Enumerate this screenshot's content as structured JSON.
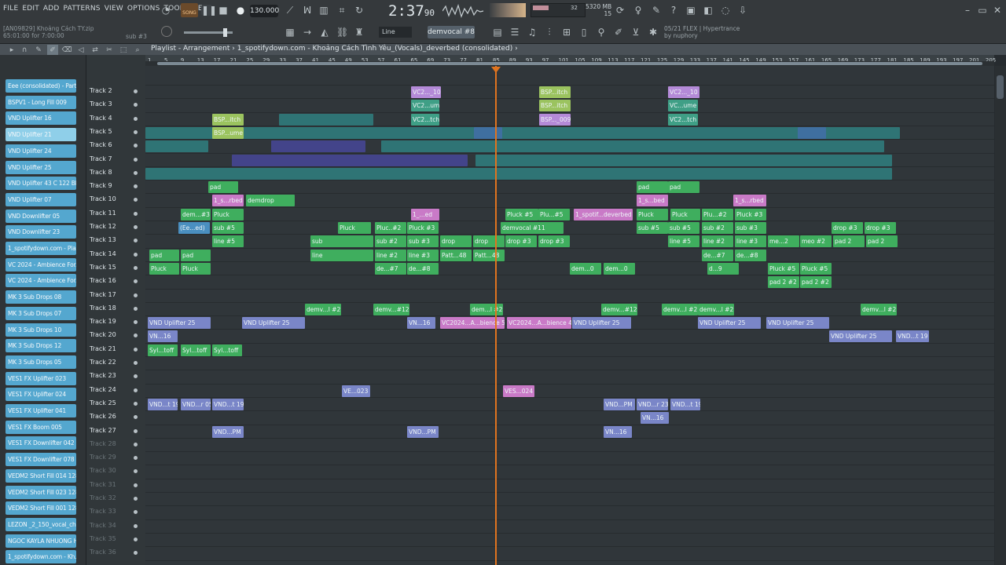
{
  "menu": [
    "FILE",
    "EDIT",
    "ADD",
    "PATTERNS",
    "VIEW",
    "OPTIONS",
    "TOOLS",
    "HELP"
  ],
  "transport": {
    "song_label": "SONG",
    "tempo": "130.000",
    "time_main": "2:37",
    "time_sub": "90"
  },
  "hint_text": {
    "line1": "[AN09829] Khoảng Cách TY.zip",
    "line2": "65:01:00 for 7:00:00",
    "right": "sub #3"
  },
  "mem": {
    "mem": "5320 MB",
    "voices": "15",
    "cpu": "32"
  },
  "snap": "Line",
  "pattern": "demvocal #8",
  "plugin_hint": {
    "line1": "05/21 FLEX | Hypertrance",
    "line2": "by nuphory"
  },
  "playlist": {
    "title": "Playlist - Arrangement",
    "breadcrumb": "1_spotifydown.com - Khoảng Cách Tình Yêu_(Vocals)_deverbed (consolidated)"
  },
  "browser_items": [
    "Eee (consolidated) - Part...",
    "BSPV1 - Long Fill 009",
    "VND Uplifter 16",
    "VND Uplifter 21",
    "VND Uplifter 24",
    "VND Uplifter 25",
    "VND Uplifter 43 C 122 BPM",
    "VND Uplifter 07",
    "VND Downlifter 05",
    "VND Downlifter 23",
    "1_spotifydown.com - Pla...",
    "VC 2024 - Ambience For...",
    "VC 2024 - Ambience For...",
    "MK 3 Sub Drops 08",
    "MK 3 Sub Drops 07",
    "MK 3 Sub Drops 10",
    "MK 3 Sub Drops 12",
    "MK 3 Sub Drops 05",
    "VES1 FX Uplifter 023",
    "VES1 FX Uplifter 024",
    "VES1 FX Uplifter 041",
    "VES1 FX Boom 005",
    "VES1 FX Downlifter 042",
    "VES1 FX Downlifter 078",
    "VEDM2 Short Fill 014 128...",
    "VEDM2 Short Fill 023 128...",
    "VEDM2 Short Fill 001 128...",
    "LEZON _2_150_vocal_ch...",
    "NGOC KAYLA NHUONG HAN...",
    "1_spotifydown.com - Kh..."
  ],
  "tracks": [
    "Track 2",
    "Track 3",
    "Track 4",
    "Track 5",
    "Track 6",
    "Track 7",
    "Track 8",
    "Track 9",
    "Track 10",
    "Track 11",
    "Track 12",
    "Track 13",
    "Track 14",
    "Track 15",
    "Track 16",
    "Track 17",
    "Track 18",
    "Track 19",
    "Track 20",
    "Track 21",
    "Track 22",
    "Track 23",
    "Track 24",
    "Track 25",
    "Track 26",
    "Track 27",
    "Track 28",
    "Track 29",
    "Track 30",
    "Track 31",
    "Track 32",
    "Track 33",
    "Track 34",
    "Track 35",
    "Track 36"
  ],
  "ruler": [
    "1",
    "5",
    "9",
    "13",
    "17",
    "21",
    "25",
    "29",
    "33",
    "37",
    "41",
    "45",
    "49",
    "53",
    "57",
    "61",
    "65",
    "69",
    "73",
    "77",
    "81",
    "85",
    "89",
    "93",
    "97",
    "101",
    "105",
    "109",
    "113",
    "117",
    "121",
    "125",
    "129",
    "133",
    "137",
    "141",
    "145",
    "149",
    "153",
    "157",
    "161",
    "165",
    "169",
    "173",
    "177",
    "181",
    "185",
    "189",
    "193",
    "197",
    "201",
    "205"
  ],
  "clips": [
    {
      "row": 0,
      "start": 338,
      "w": 38,
      "label": "VC2..._10",
      "color": "#b48ad8"
    },
    {
      "row": 0,
      "start": 501,
      "w": 40,
      "label": "BSP...itch",
      "color": "#9bc35f"
    },
    {
      "row": 0,
      "start": 665,
      "w": 40,
      "label": "VC2..._10",
      "color": "#b48ad8"
    },
    {
      "row": 1,
      "start": 338,
      "w": 36,
      "label": "VC2...ume",
      "color": "#3f9f86"
    },
    {
      "row": 1,
      "start": 501,
      "w": 40,
      "label": "BSP...itch",
      "color": "#9bc35f"
    },
    {
      "row": 1,
      "start": 665,
      "w": 38,
      "label": "VC...ume",
      "color": "#3f9f86"
    },
    {
      "row": 2,
      "start": 85,
      "w": 40,
      "label": "BSP...itch",
      "color": "#9bc35f"
    },
    {
      "row": 2,
      "start": 338,
      "w": 36,
      "label": "VC2...tch",
      "color": "#3f9f86"
    },
    {
      "row": 2,
      "start": 501,
      "w": 40,
      "label": "BSP..._009",
      "color": "#b48ad8"
    },
    {
      "row": 2,
      "start": 665,
      "w": 38,
      "label": "VC2...tch",
      "color": "#3f9f86"
    },
    {
      "row": 3,
      "start": 85,
      "w": 40,
      "label": "BSP...ume",
      "color": "#9bc35f"
    },
    {
      "row": 3,
      "start": 418,
      "w": 36,
      "label": "",
      "color": "#3f6fa0"
    },
    {
      "row": 3,
      "start": 830,
      "w": 36,
      "label": "",
      "color": "#3f6fa0"
    },
    {
      "row": 7,
      "start": 80,
      "w": 38,
      "label": "pad",
      "color": "#3fae5e"
    },
    {
      "row": 7,
      "start": 625,
      "w": 40,
      "label": "pad",
      "color": "#3fae5e"
    },
    {
      "row": 7,
      "start": 665,
      "w": 40,
      "label": "pad",
      "color": "#3fae5e"
    },
    {
      "row": 8,
      "start": 85,
      "w": 40,
      "label": "1_s...rbed",
      "color": "#c97ac7"
    },
    {
      "row": 8,
      "start": 128,
      "w": 62,
      "label": "demdrop",
      "color": "#3fae5e"
    },
    {
      "row": 8,
      "start": 625,
      "w": 40,
      "label": "1_s...bed",
      "color": "#c97ac7"
    },
    {
      "row": 8,
      "start": 748,
      "w": 42,
      "label": "1_s...rbed",
      "color": "#c97ac7"
    },
    {
      "row": 9,
      "start": 45,
      "w": 38,
      "label": "dem...#3",
      "color": "#3fae5e"
    },
    {
      "row": 9,
      "start": 85,
      "w": 40,
      "label": "Pluck",
      "color": "#3fae5e"
    },
    {
      "row": 9,
      "start": 338,
      "w": 36,
      "label": "1_...ed",
      "color": "#c97ac7"
    },
    {
      "row": 9,
      "start": 458,
      "w": 42,
      "label": "Pluck #5",
      "color": "#3fae5e"
    },
    {
      "row": 9,
      "start": 500,
      "w": 40,
      "label": "Plu...#5",
      "color": "#3fae5e"
    },
    {
      "row": 9,
      "start": 545,
      "w": 75,
      "label": "1_spotif...deverbed",
      "color": "#c97ac7"
    },
    {
      "row": 9,
      "start": 625,
      "w": 40,
      "label": "Pluck",
      "color": "#3fae5e"
    },
    {
      "row": 9,
      "start": 668,
      "w": 38,
      "label": "Pluck",
      "color": "#3fae5e"
    },
    {
      "row": 9,
      "start": 708,
      "w": 40,
      "label": "Plu...#2",
      "color": "#3fae5e"
    },
    {
      "row": 9,
      "start": 750,
      "w": 40,
      "label": "Pluck #3",
      "color": "#3fae5e"
    },
    {
      "row": 10,
      "start": 42,
      "w": 40,
      "label": "(Ee...ed)",
      "color": "#4a8fc0"
    },
    {
      "row": 10,
      "start": 85,
      "w": 40,
      "label": "sub #5",
      "color": "#3fae5e"
    },
    {
      "row": 10,
      "start": 245,
      "w": 42,
      "label": "Pluck",
      "color": "#3fae5e"
    },
    {
      "row": 10,
      "start": 292,
      "w": 40,
      "label": "Pluc..#2",
      "color": "#3fae5e"
    },
    {
      "row": 10,
      "start": 333,
      "w": 40,
      "label": "Pluck #3",
      "color": "#3fae5e"
    },
    {
      "row": 10,
      "start": 452,
      "w": 80,
      "label": "demvocal #11",
      "color": "#3fae5e"
    },
    {
      "row": 10,
      "start": 625,
      "w": 40,
      "label": "sub #5",
      "color": "#3fae5e"
    },
    {
      "row": 10,
      "start": 665,
      "w": 40,
      "label": "sub #5",
      "color": "#3fae5e"
    },
    {
      "row": 10,
      "start": 708,
      "w": 40,
      "label": "sub #2",
      "color": "#3fae5e"
    },
    {
      "row": 10,
      "start": 750,
      "w": 40,
      "label": "sub #3",
      "color": "#3fae5e"
    },
    {
      "row": 10,
      "start": 873,
      "w": 40,
      "label": "drop #3",
      "color": "#3fae5e"
    },
    {
      "row": 10,
      "start": 915,
      "w": 40,
      "label": "drop #3",
      "color": "#3fae5e"
    },
    {
      "row": 11,
      "start": 85,
      "w": 40,
      "label": "line #5",
      "color": "#3fae5e"
    },
    {
      "row": 11,
      "start": 210,
      "w": 80,
      "label": "sub",
      "color": "#3fae5e"
    },
    {
      "row": 11,
      "start": 292,
      "w": 40,
      "label": "sub #2",
      "color": "#3fae5e"
    },
    {
      "row": 11,
      "start": 333,
      "w": 40,
      "label": "sub #3",
      "color": "#3fae5e"
    },
    {
      "row": 11,
      "start": 375,
      "w": 40,
      "label": "drop",
      "color": "#3fae5e"
    },
    {
      "row": 11,
      "start": 417,
      "w": 40,
      "label": "drop",
      "color": "#3fae5e"
    },
    {
      "row": 11,
      "start": 458,
      "w": 40,
      "label": "drop #3",
      "color": "#3fae5e"
    },
    {
      "row": 11,
      "start": 500,
      "w": 40,
      "label": "drop #3",
      "color": "#3fae5e"
    },
    {
      "row": 11,
      "start": 665,
      "w": 40,
      "label": "line #5",
      "color": "#3fae5e"
    },
    {
      "row": 11,
      "start": 708,
      "w": 40,
      "label": "line #2",
      "color": "#3fae5e"
    },
    {
      "row": 11,
      "start": 750,
      "w": 40,
      "label": "line #3",
      "color": "#3fae5e"
    },
    {
      "row": 11,
      "start": 792,
      "w": 40,
      "label": "me...2",
      "color": "#3fae5e"
    },
    {
      "row": 11,
      "start": 833,
      "w": 40,
      "label": "meo #2",
      "color": "#3fae5e"
    },
    {
      "row": 11,
      "start": 875,
      "w": 40,
      "label": "pad 2",
      "color": "#3fae5e"
    },
    {
      "row": 11,
      "start": 917,
      "w": 40,
      "label": "pad 2",
      "color": "#3fae5e"
    },
    {
      "row": 12,
      "start": 5,
      "w": 38,
      "label": "pad",
      "color": "#3fae5e"
    },
    {
      "row": 12,
      "start": 45,
      "w": 38,
      "label": "pad",
      "color": "#3fae5e"
    },
    {
      "row": 12,
      "start": 210,
      "w": 80,
      "label": "line",
      "color": "#3fae5e"
    },
    {
      "row": 12,
      "start": 292,
      "w": 40,
      "label": "line #2",
      "color": "#3fae5e"
    },
    {
      "row": 12,
      "start": 333,
      "w": 40,
      "label": "line #3",
      "color": "#3fae5e"
    },
    {
      "row": 12,
      "start": 375,
      "w": 40,
      "label": "Patt...48",
      "color": "#3fae5e"
    },
    {
      "row": 12,
      "start": 417,
      "w": 40,
      "label": "Patt...48",
      "color": "#3fae5e"
    },
    {
      "row": 12,
      "start": 708,
      "w": 40,
      "label": "de...#7",
      "color": "#3fae5e"
    },
    {
      "row": 12,
      "start": 750,
      "w": 40,
      "label": "de...#8",
      "color": "#3fae5e"
    },
    {
      "row": 13,
      "start": 5,
      "w": 38,
      "label": "Pluck",
      "color": "#3fae5e"
    },
    {
      "row": 13,
      "start": 45,
      "w": 38,
      "label": "Pluck",
      "color": "#3fae5e"
    },
    {
      "row": 13,
      "start": 292,
      "w": 40,
      "label": "de...#7",
      "color": "#3fae5e"
    },
    {
      "row": 13,
      "start": 333,
      "w": 40,
      "label": "de...#8",
      "color": "#3fae5e"
    },
    {
      "row": 13,
      "start": 540,
      "w": 40,
      "label": "dem...0",
      "color": "#3fae5e"
    },
    {
      "row": 13,
      "start": 583,
      "w": 40,
      "label": "dem...0",
      "color": "#3fae5e"
    },
    {
      "row": 13,
      "start": 715,
      "w": 40,
      "label": "d...9",
      "color": "#3fae5e"
    },
    {
      "row": 13,
      "start": 792,
      "w": 40,
      "label": "Pluck #5",
      "color": "#3fae5e"
    },
    {
      "row": 13,
      "start": 833,
      "w": 40,
      "label": "Pluck #5",
      "color": "#3fae5e"
    },
    {
      "row": 14,
      "start": 792,
      "w": 40,
      "label": "pad 2 #2",
      "color": "#3fae5e"
    },
    {
      "row": 14,
      "start": 833,
      "w": 40,
      "label": "pad 2 #2",
      "color": "#3fae5e"
    },
    {
      "row": 16,
      "start": 203,
      "w": 46,
      "label": "demv...l #2",
      "color": "#3fae5e"
    },
    {
      "row": 16,
      "start": 290,
      "w": 46,
      "label": "demv...#12",
      "color": "#3fae5e"
    },
    {
      "row": 16,
      "start": 413,
      "w": 42,
      "label": "dem...l #2",
      "color": "#3fae5e"
    },
    {
      "row": 16,
      "start": 580,
      "w": 46,
      "label": "demv...#12",
      "color": "#3fae5e"
    },
    {
      "row": 16,
      "start": 657,
      "w": 46,
      "label": "demv...l #2",
      "color": "#3fae5e"
    },
    {
      "row": 16,
      "start": 703,
      "w": 46,
      "label": "demv...l #2",
      "color": "#3fae5e"
    },
    {
      "row": 16,
      "start": 910,
      "w": 46,
      "label": "demv...l #2",
      "color": "#3fae5e"
    },
    {
      "row": 17,
      "start": 3,
      "w": 80,
      "label": "VND Uplifter 25",
      "color": "#7a86c8"
    },
    {
      "row": 17,
      "start": 123,
      "w": 80,
      "label": "VND Uplifter 25",
      "color": "#7a86c8"
    },
    {
      "row": 17,
      "start": 333,
      "w": 36,
      "label": "VN...16",
      "color": "#7a86c8"
    },
    {
      "row": 17,
      "start": 375,
      "w": 82,
      "label": "VC2024...A...bience 55",
      "color": "#c97ac7"
    },
    {
      "row": 17,
      "start": 460,
      "w": 82,
      "label": "VC2024...A...bience 47",
      "color": "#c97ac7"
    },
    {
      "row": 17,
      "start": 543,
      "w": 75,
      "label": "VND Uplifter 25",
      "color": "#7a86c8"
    },
    {
      "row": 17,
      "start": 703,
      "w": 80,
      "label": "VND Uplifter 25",
      "color": "#7a86c8"
    },
    {
      "row": 17,
      "start": 790,
      "w": 80,
      "label": "VND Uplifter 25",
      "color": "#7a86c8"
    },
    {
      "row": 18,
      "start": 3,
      "w": 38,
      "label": "VN...16",
      "color": "#7a86c8"
    },
    {
      "row": 18,
      "start": 870,
      "w": 80,
      "label": "VND Uplifter 25",
      "color": "#7a86c8"
    },
    {
      "row": 18,
      "start": 955,
      "w": 42,
      "label": "VND...t 19",
      "color": "#7a86c8"
    },
    {
      "row": 19,
      "start": 3,
      "w": 38,
      "label": "Syl...toff",
      "color": "#3fae5e"
    },
    {
      "row": 19,
      "start": 45,
      "w": 38,
      "label": "Syl...toff",
      "color": "#3fae5e"
    },
    {
      "row": 19,
      "start": 85,
      "w": 38,
      "label": "Syl...toff",
      "color": "#3fae5e"
    },
    {
      "row": 22,
      "start": 250,
      "w": 36,
      "label": "VE...023",
      "color": "#7a86c8"
    },
    {
      "row": 22,
      "start": 455,
      "w": 40,
      "label": "VES...024",
      "color": "#c97ac7"
    },
    {
      "row": 23,
      "start": 3,
      "w": 38,
      "label": "VND...t 19",
      "color": "#7a86c8"
    },
    {
      "row": 23,
      "start": 45,
      "w": 38,
      "label": "VND...r 05",
      "color": "#7a86c8"
    },
    {
      "row": 23,
      "start": 85,
      "w": 40,
      "label": "VND...t 19",
      "color": "#7a86c8"
    },
    {
      "row": 23,
      "start": 583,
      "w": 40,
      "label": "VND...PM",
      "color": "#7a86c8"
    },
    {
      "row": 23,
      "start": 625,
      "w": 40,
      "label": "VND...r 23",
      "color": "#7a86c8"
    },
    {
      "row": 23,
      "start": 668,
      "w": 38,
      "label": "VND...t 19",
      "color": "#7a86c8"
    },
    {
      "row": 24,
      "start": 630,
      "w": 36,
      "label": "VN...16",
      "color": "#7a86c8"
    },
    {
      "row": 25,
      "start": 85,
      "w": 40,
      "label": "VND...PM",
      "color": "#7a86c8"
    },
    {
      "row": 25,
      "start": 333,
      "w": 40,
      "label": "VND...PM",
      "color": "#7a86c8"
    },
    {
      "row": 25,
      "start": 583,
      "w": 36,
      "label": "VN...16",
      "color": "#7a86c8"
    }
  ]
}
